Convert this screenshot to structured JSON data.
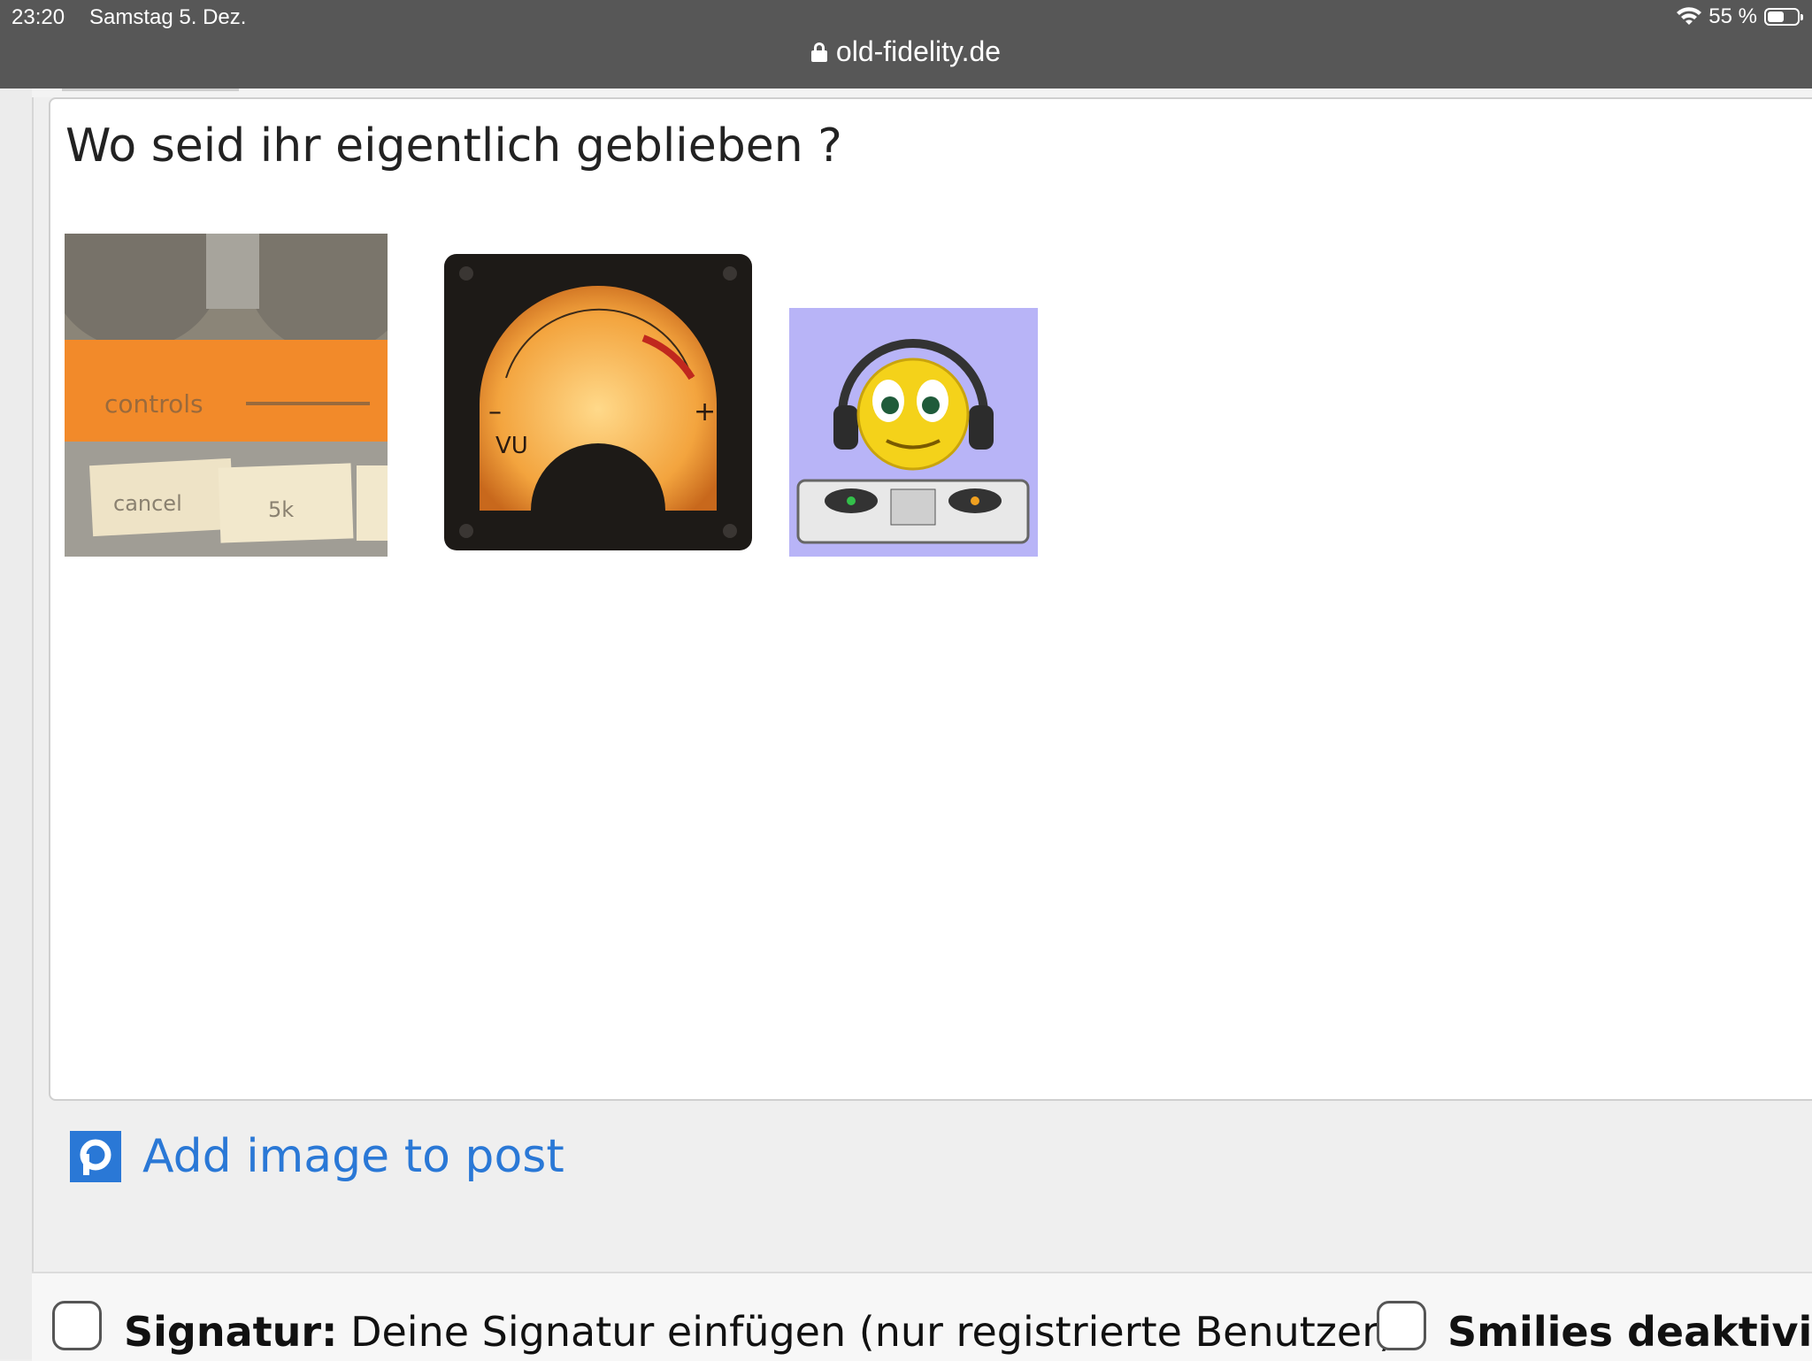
{
  "status_bar": {
    "time": "23:20",
    "date": "Samstag 5. Dez.",
    "battery": "55 %",
    "url": "old-fidelity.de"
  },
  "post": {
    "text": "Wo seid ihr eigentlich geblieben ?",
    "images": [
      {
        "name": "controls-panel-image",
        "labels": [
          "controls",
          "cancel",
          "5k"
        ]
      },
      {
        "name": "vu-meter-image",
        "labels": [
          "VU"
        ]
      },
      {
        "name": "dj-smiley-image",
        "labels": []
      }
    ]
  },
  "add_image": {
    "label": "Add image to post",
    "icon": "p-icon",
    "color": "#2a78d6"
  },
  "options": {
    "signature_bold": "Signatur:",
    "signature_text": "Deine Signatur einfügen (nur registrierte Benutzer).",
    "smilies_bold": "Smilies deaktivie"
  }
}
